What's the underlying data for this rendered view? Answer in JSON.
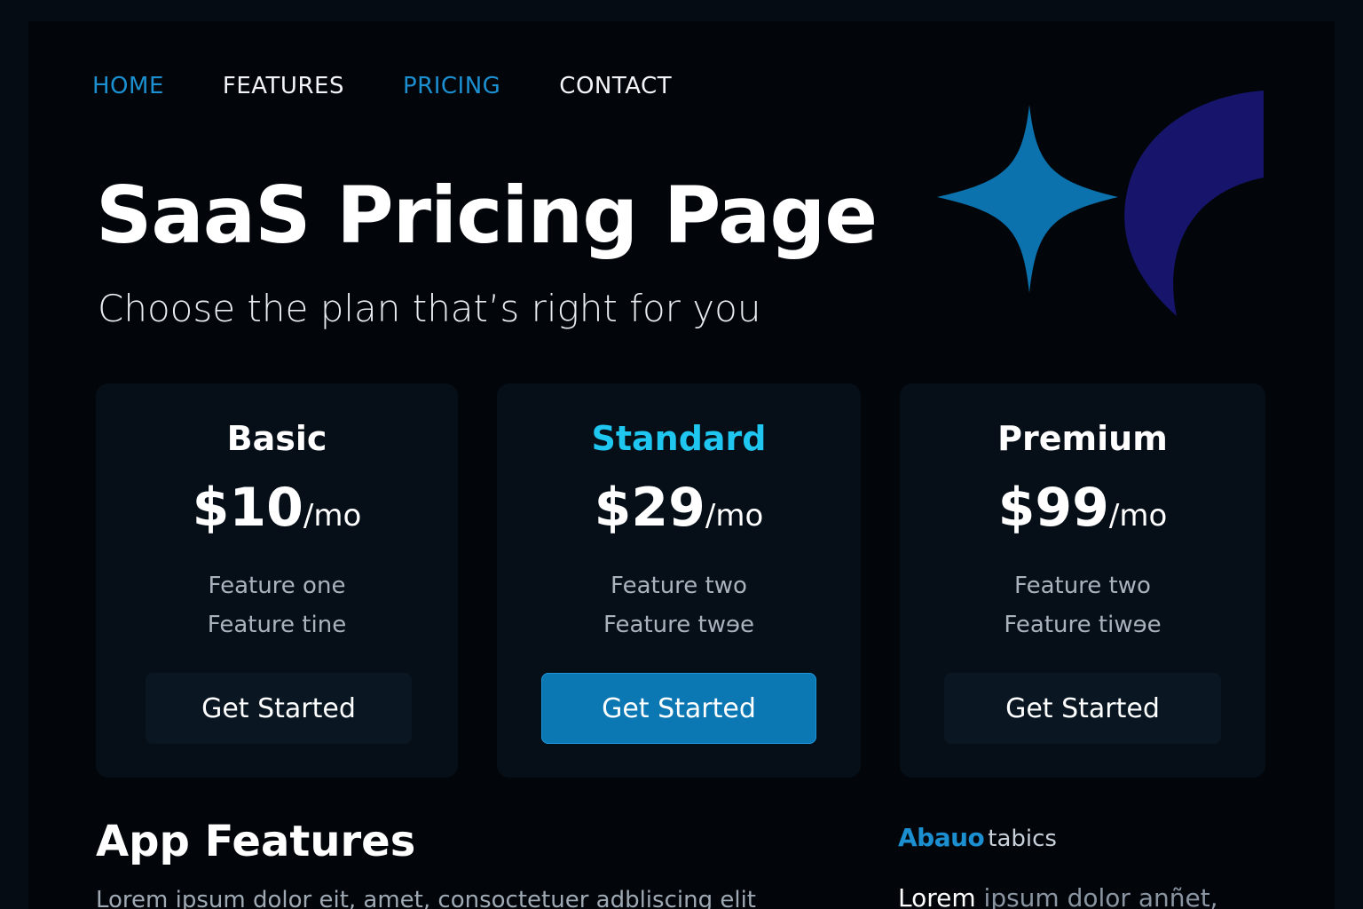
{
  "nav": {
    "items": [
      {
        "label": "HOME",
        "active": true
      },
      {
        "label": "FEATURES",
        "active": false
      },
      {
        "label": "PRICING",
        "active": true
      },
      {
        "label": "CONTACT",
        "active": false
      }
    ]
  },
  "hero": {
    "title": "SaaS Pricing Page",
    "subtitle": "Choose the plan that’s right for you",
    "decoration": [
      "four-point-star-icon",
      "crescent-shape"
    ]
  },
  "plans": [
    {
      "name": "Basic",
      "amount": "$10",
      "period": "/mo",
      "features": [
        "Feature one",
        "Feature tine"
      ],
      "cta": "Get Started",
      "featured": false
    },
    {
      "name": "Standard",
      "amount": "$29",
      "period": "/mo",
      "features": [
        "Feature two",
        "Feature twɘe"
      ],
      "cta": "Get Started",
      "featured": true
    },
    {
      "name": "Premium",
      "amount": "$99",
      "period": "/mo",
      "features": [
        "Feature two",
        "Feature tiwɘe"
      ],
      "cta": "Get Started",
      "featured": false
    }
  ],
  "app_features": {
    "title": "App Features",
    "body": "Lorem ipsum dolor eit, amet, consoctetuer adbliscing elit"
  },
  "brand": {
    "mark": "Abauo",
    "word": "tabics",
    "body_lead": "Lorem",
    "body_rest": " ipsum dolor anñet,"
  },
  "colors": {
    "background": "#02060b",
    "accent": "#1b8fd0",
    "featured_title": "#1ec6f0",
    "primary_button": "#0b78b4",
    "card": "#060f18",
    "crescent": "#16156b"
  }
}
